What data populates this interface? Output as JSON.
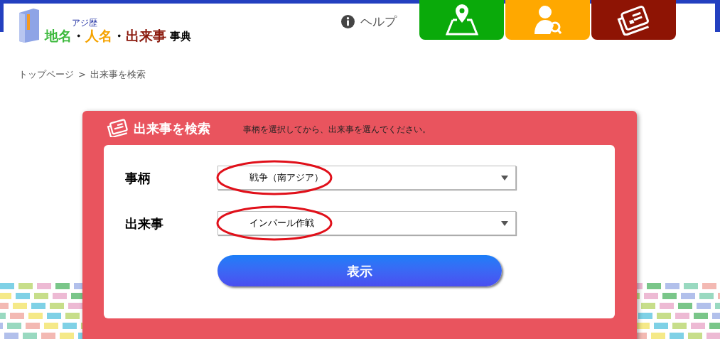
{
  "logo": {
    "kicker": "アジ歴",
    "parts": [
      {
        "text": "地名",
        "color": "#3cb93c"
      },
      {
        "text": "・",
        "color": "#111111"
      },
      {
        "text": "人名",
        "color": "#f5a300"
      },
      {
        "text": "・",
        "color": "#111111"
      },
      {
        "text": "出来事",
        "color": "#8b1a0e"
      }
    ],
    "suffix": "事典"
  },
  "help": {
    "label": "ヘルプ"
  },
  "nav_tabs": [
    {
      "kind": "map",
      "color": "#0aaa0a"
    },
    {
      "kind": "person",
      "color": "#ffa800"
    },
    {
      "kind": "news",
      "color": "#8e1404"
    }
  ],
  "breadcrumb": {
    "items": [
      "トップページ",
      "出来事を検索"
    ],
    "separator": ">"
  },
  "panel": {
    "title": "出来事を検索",
    "hint": "事柄を選択してから、出来事を選んでください。",
    "fields": [
      {
        "label": "事柄",
        "value": "戦争（南アジア）",
        "highlighted": true
      },
      {
        "label": "出来事",
        "value": "インパール作戦",
        "highlighted": true
      }
    ],
    "button": "表示"
  }
}
